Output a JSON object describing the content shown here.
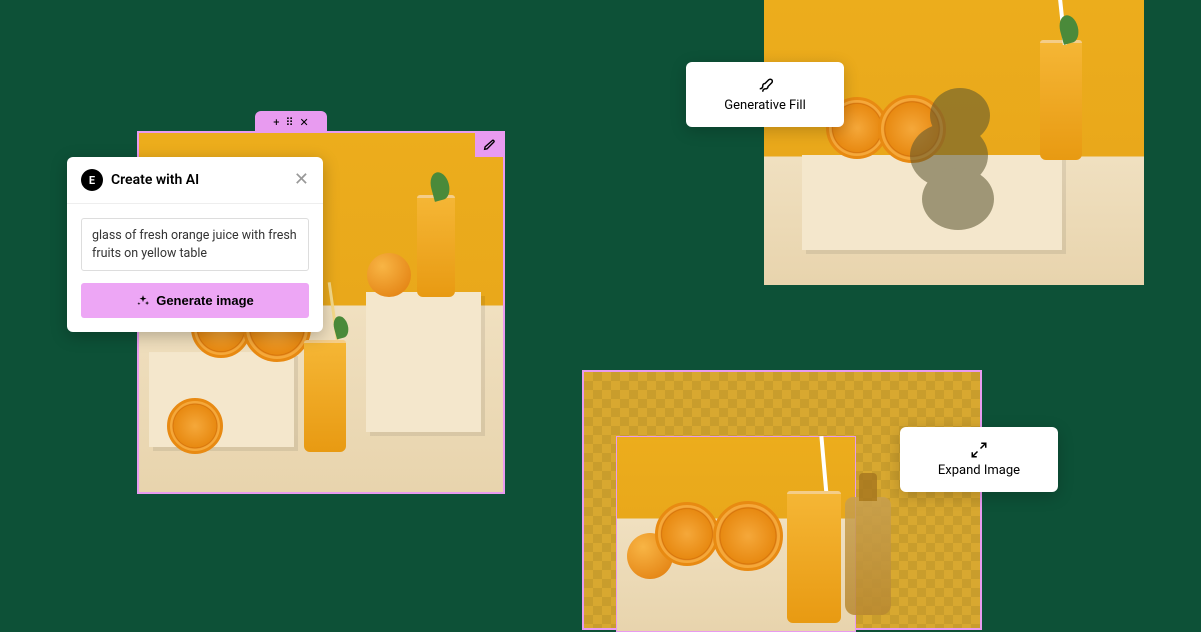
{
  "createPanel": {
    "title": "Create with AI",
    "prompt": "glass of fresh orange juice with fresh fruits on yellow table",
    "generateLabel": "Generate image"
  },
  "generativeFill": {
    "label": "Generative Fill"
  },
  "expandImage": {
    "label": "Expand Image"
  }
}
